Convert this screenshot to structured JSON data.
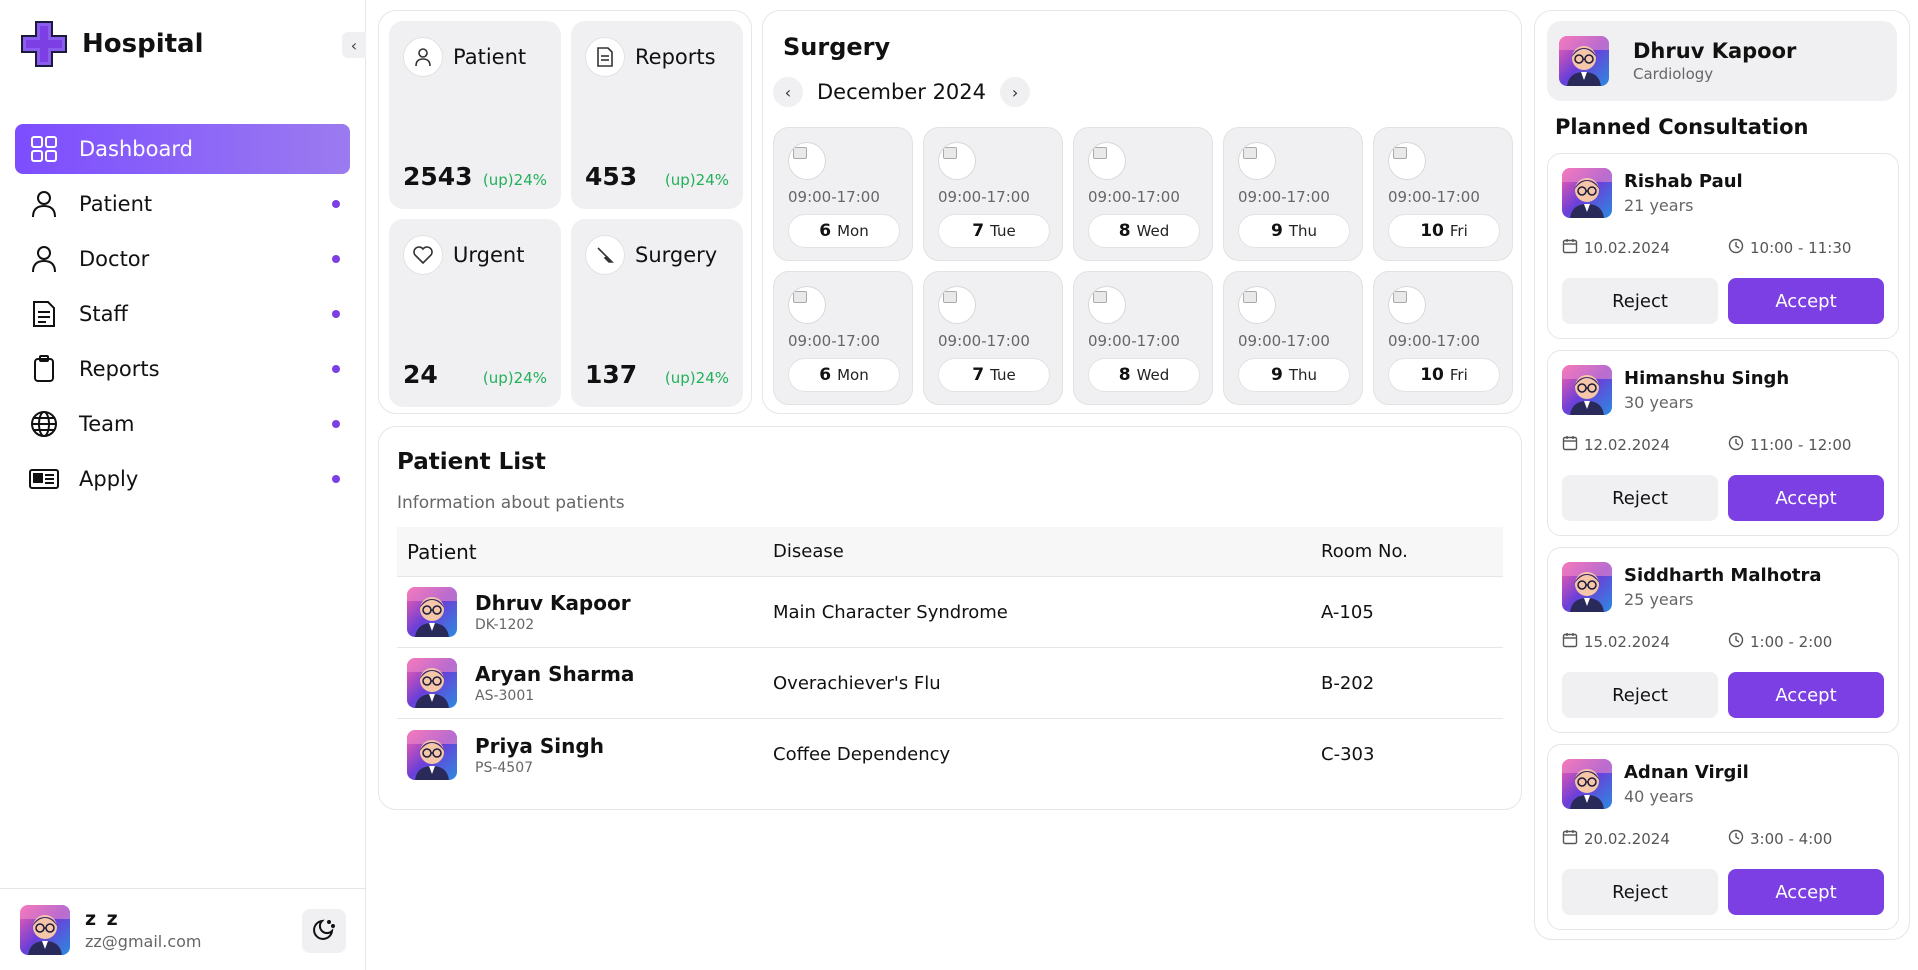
{
  "brand": {
    "name": "Hospital",
    "accent": "#7b3fe4"
  },
  "sidebar": {
    "collapse_icon": "chevron-left-icon",
    "items": [
      {
        "label": "Dashboard",
        "icon": "grid-icon",
        "active": true
      },
      {
        "label": "Patient",
        "icon": "user-icon",
        "active": false
      },
      {
        "label": "Doctor",
        "icon": "user-icon",
        "active": false
      },
      {
        "label": "Staff",
        "icon": "document-icon",
        "active": false
      },
      {
        "label": "Reports",
        "icon": "clipboard-icon",
        "active": false
      },
      {
        "label": "Team",
        "icon": "globe-icon",
        "active": false
      },
      {
        "label": "Apply",
        "icon": "id-card-icon",
        "active": false
      }
    ],
    "user": {
      "name": "z z",
      "email": "zz@gmail.com"
    },
    "theme_icon": "moon-icon"
  },
  "stats": [
    {
      "label": "Patient",
      "value": "2543",
      "change": "(up)24%",
      "icon": "user-icon"
    },
    {
      "label": "Reports",
      "value": "453",
      "change": "(up)24%",
      "icon": "document-icon"
    },
    {
      "label": "Urgent",
      "value": "24",
      "change": "(up)24%",
      "icon": "heart-icon"
    },
    {
      "label": "Surgery",
      "value": "137",
      "change": "(up)24%",
      "icon": "scalpel-icon"
    }
  ],
  "surgery": {
    "title": "Surgery",
    "month": "December 2024",
    "days": [
      {
        "num": "6",
        "name": "Mon",
        "time": "09:00-17:00",
        "img_alt": "img"
      },
      {
        "num": "7",
        "name": "Tue",
        "time": "09:00-17:00",
        "img_alt": "img"
      },
      {
        "num": "8",
        "name": "Wed",
        "time": "09:00-17:00",
        "img_alt": "img"
      },
      {
        "num": "9",
        "name": "Thu",
        "time": "09:00-17:00",
        "img_alt": "img"
      },
      {
        "num": "10",
        "name": "Fri",
        "time": "09:00-17:00",
        "img_alt": "img"
      },
      {
        "num": "6",
        "name": "Mon",
        "time": "09:00-17:00",
        "img_alt": "img"
      },
      {
        "num": "7",
        "name": "Tue",
        "time": "09:00-17:00",
        "img_alt": "img"
      },
      {
        "num": "8",
        "name": "Wed",
        "time": "09:00-17:00",
        "img_alt": "img"
      },
      {
        "num": "9",
        "name": "Thu",
        "time": "09:00-17:00",
        "img_alt": "img"
      },
      {
        "num": "10",
        "name": "Fri",
        "time": "09:00-17:00",
        "img_alt": "img"
      }
    ]
  },
  "patient_list": {
    "title": "Patient List",
    "subtitle": "Information about patients",
    "headers": [
      "Patient",
      "Disease",
      "Room No."
    ],
    "rows": [
      {
        "name": "Dhruv Kapoor",
        "id": "DK-1202",
        "disease": "Main Character Syndrome",
        "room": "A-105"
      },
      {
        "name": "Aryan Sharma",
        "id": "AS-3001",
        "disease": "Overachiever's Flu",
        "room": "B-202"
      },
      {
        "name": "Priya Singh",
        "id": "PS-4507",
        "disease": "Coffee Dependency",
        "room": "C-303"
      }
    ]
  },
  "doctor": {
    "name": "Dhruv Kapoor",
    "department": "Cardiology"
  },
  "consultations": {
    "title": "Planned Consultation",
    "reject_label": "Reject",
    "accept_label": "Accept",
    "items": [
      {
        "name": "Rishab Paul",
        "age": "21 years",
        "date": "10.02.2024",
        "time": "10:00 - 11:30"
      },
      {
        "name": "Himanshu Singh",
        "age": "30 years",
        "date": "12.02.2024",
        "time": "11:00 - 12:00"
      },
      {
        "name": "Siddharth Malhotra",
        "age": "25 years",
        "date": "15.02.2024",
        "time": "1:00 - 2:00"
      },
      {
        "name": "Adnan Virgil",
        "age": "40 years",
        "date": "20.02.2024",
        "time": "3:00 - 4:00"
      }
    ]
  }
}
